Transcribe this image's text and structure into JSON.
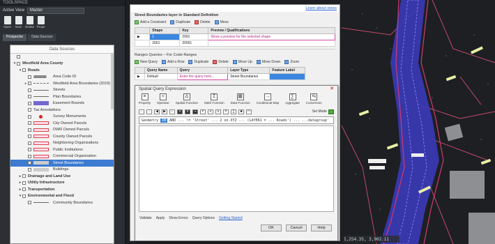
{
  "toolspace": {
    "title": "TOOLSPACE",
    "active_drawing_label": "Active View",
    "active_drawing_value": "Master",
    "icons": [
      {
        "name": "open-icon",
        "label": "Open"
      },
      {
        "name": "new-icon",
        "label": "New"
      },
      {
        "name": "delete-icon",
        "label": "Delete"
      },
      {
        "name": "properties-icon",
        "label": "Props"
      }
    ],
    "tabs": [
      "Prospector",
      "Data Sources"
    ]
  },
  "prospector": {
    "header": "Data Sources",
    "items": [
      {
        "label": "",
        "level": 0,
        "expand": "",
        "swatch": "none"
      },
      {
        "label": "Westfield Area County",
        "level": 0,
        "expand": "▾",
        "swatch": "none",
        "bold": true
      },
      {
        "label": "Roads",
        "level": 1,
        "expand": "▾",
        "swatch": "none",
        "bold": true
      },
      {
        "label": "Area Code ID",
        "level": 2,
        "expand": "",
        "swatch": "cloud"
      },
      {
        "label": "Westfield Area Boundaries (2019)",
        "level": 2,
        "expand": "▸",
        "swatch": "dash"
      },
      {
        "label": "Streets",
        "level": 2,
        "expand": "",
        "swatch": "line"
      },
      {
        "label": "Plan Boundaries",
        "level": 2,
        "expand": "",
        "swatch": "line"
      },
      {
        "label": "Easement Bounds",
        "level": 2,
        "expand": "",
        "swatch": "purple"
      },
      {
        "label": "Tax Annotations",
        "level": 2,
        "expand": "",
        "swatch": "none"
      },
      {
        "label": "Survey Monuments",
        "level": 2,
        "expand": "",
        "swatch": "red-dot"
      },
      {
        "label": "City Owned Parcels",
        "level": 2,
        "expand": "",
        "swatch": "red-outline"
      },
      {
        "label": "DWR Owned Parcels",
        "level": 2,
        "expand": "",
        "swatch": "red-outline"
      },
      {
        "label": "County Owned Parcels",
        "level": 2,
        "expand": "",
        "swatch": "red-outline"
      },
      {
        "label": "Neighboring Organizations",
        "level": 2,
        "expand": "",
        "swatch": "red-outline"
      },
      {
        "label": "Public Institutions",
        "level": 2,
        "expand": "",
        "swatch": "red-outline"
      },
      {
        "label": "Commercial Organization",
        "level": 2,
        "expand": "",
        "swatch": "red-outline"
      },
      {
        "label": "Street Boundaries",
        "level": 2,
        "expand": "",
        "swatch": "grey",
        "selected": true
      },
      {
        "label": "Buildings",
        "level": 2,
        "expand": "",
        "swatch": "grey"
      },
      {
        "label": "Drainage and Land Use",
        "level": 1,
        "expand": "▸",
        "swatch": "none",
        "bold": true
      },
      {
        "label": "Utility Infrastructure",
        "level": 1,
        "expand": "▸",
        "swatch": "none",
        "bold": true
      },
      {
        "label": "Transportation",
        "level": 1,
        "expand": "▸",
        "swatch": "none",
        "bold": true
      },
      {
        "label": "Environmental and Flood",
        "level": 1,
        "expand": "▾",
        "swatch": "none",
        "bold": true
      },
      {
        "label": "Community Boundaries",
        "level": 2,
        "expand": "",
        "swatch": "line"
      }
    ]
  },
  "back_dialog": {
    "help_link": "Learn about views",
    "ref_label": "Street Boundaries layer in Standard Definition",
    "toolbar": [
      "Add a Constraint",
      "Duplicate",
      "Delete",
      "Move"
    ],
    "table1": {
      "headers": [
        "",
        "Shape",
        "Key",
        "Preview / Qualifications"
      ],
      "rows": [
        [
          "▶",
          "1",
          "2001",
          "Show a preview for the selected shape"
        ],
        [
          "",
          "2001",
          "20001",
          ""
        ]
      ]
    },
    "section_label": "Ranges Queries – For Code Ranges",
    "toolbar2": [
      "New Query",
      "Add a Row",
      "Duplicate",
      "Delete",
      "Move Up",
      "Move Down",
      "Zoom"
    ],
    "table2": {
      "headers": [
        "",
        "Query Name",
        "Query",
        "Layer Type",
        "Feature Label"
      ],
      "rows": [
        [
          "▶",
          "Default",
          "Enter the query here...",
          "Street Boundaries",
          ""
        ]
      ]
    }
  },
  "query_builder": {
    "title": "Spatial Query Expression",
    "tools": [
      {
        "name": "property-tool",
        "label": "Property",
        "glyph": "≡"
      },
      {
        "name": "operator-tool",
        "label": "Operator",
        "glyph": "<"
      },
      {
        "name": "spatial-function-tool",
        "label": "Spatial Function",
        "glyph": "∆"
      },
      {
        "name": "math-function-tool",
        "label": "Math Function",
        "glyph": "Σ"
      },
      {
        "name": "data-function-tool",
        "label": "Data Function",
        "glyph": "▦"
      },
      {
        "name": "conditional-map-tool",
        "label": "Conditional Map",
        "glyph": "→"
      },
      {
        "name": "aggregate-tool",
        "label": "Aggregate",
        "glyph": "∑"
      },
      {
        "name": "conversion-tool",
        "label": "Conversion",
        "glyph": "⇆"
      }
    ],
    "mini_buttons": [
      "←",
      "→",
      "◀",
      "▶",
      "−",
      "∧",
      "∨",
      "¬",
      "≠",
      "≤",
      "≥",
      "=",
      "∑",
      "■",
      "□"
    ],
    "set_mode_label": "Set Mode",
    "sql_prefix": "Geometry",
    "sql_token": "IN",
    "sql_rest": "AND ... != 'Street' ... 2 on.XYZ ... (LAYER1 = ... Roads') ... ...datagroup'",
    "bottom": {
      "label1": "Validate",
      "label2": "Apply",
      "label3": "Show Errors",
      "label4": "Query Options",
      "link": "Getting Started"
    },
    "buttons": [
      "OK",
      "Cancel",
      "Help"
    ]
  },
  "map": {
    "coord_readout": "1,254.35, 3,902.11"
  }
}
